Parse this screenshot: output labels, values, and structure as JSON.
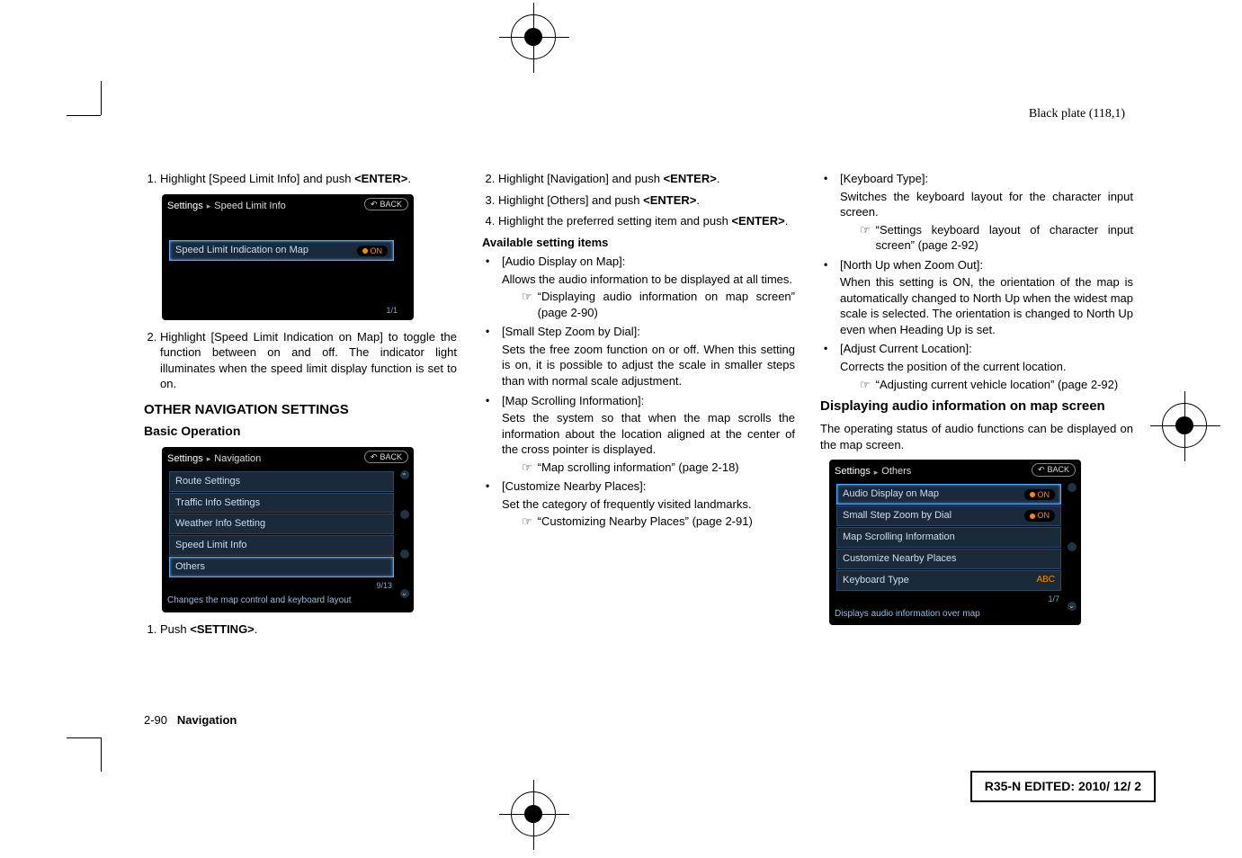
{
  "header": {
    "blackplate": "Black plate (118,1)"
  },
  "col1": {
    "step1": "Highlight [Speed Limit Info] and push ",
    "enter": "<ENTER>",
    "step2": "Highlight [Speed Limit Indication on Map] to toggle the function between on and off. The indicator light illuminates when the speed limit display function is set to on.",
    "sect_other": "OTHER NAVIGATION SETTINGS",
    "sub_basic": "Basic Operation",
    "push_setting_pre": "Push ",
    "setting": "<SETTING>"
  },
  "shot1": {
    "crumb1": "Settings",
    "crumb2": "Speed Limit Info",
    "back": "BACK",
    "row1": "Speed Limit Indication on Map",
    "on": "ON",
    "page": "1/1"
  },
  "shot2": {
    "crumb1": "Settings",
    "crumb2": "Navigation",
    "back": "BACK",
    "r1": "Route Settings",
    "r2": "Traffic Info Settings",
    "r3": "Weather Info Setting",
    "r4": "Speed Limit Info",
    "r5": "Others",
    "page": "9/13",
    "cap": "Changes the map control and keyboard layout"
  },
  "col2": {
    "s2": "Highlight [Navigation] and push ",
    "s3": "Highlight [Others] and push ",
    "s4": "Highlight the preferred setting item and push ",
    "enter": "<ENTER>",
    "avail": "Available setting items",
    "b1t": "[Audio Display on Map]:",
    "b1d": "Allows the audio information to be displayed at all times.",
    "b1r": "“Displaying audio information on map screen” (page 2-90)",
    "b2t": "[Small Step Zoom by Dial]:",
    "b2d": "Sets the free zoom function on or off. When this setting is on, it is possible to adjust the scale in smaller steps than with normal scale adjustment.",
    "b3t": "[Map Scrolling Information]:",
    "b3d": "Sets the system so that when the map scrolls the information about the location aligned at the center of the cross pointer is displayed.",
    "b3r": "“Map scrolling information” (page 2-18)",
    "b4t": "[Customize Nearby Places]:",
    "b4d": "Set the category of frequently visited landmarks.",
    "b4r": "“Customizing Nearby Places” (page 2-91)"
  },
  "col3": {
    "b5t": "[Keyboard Type]:",
    "b5d": "Switches the keyboard layout for the character input screen.",
    "b5r": "“Settings keyboard layout of character input screen” (page 2-92)",
    "b6t": "[North Up when Zoom Out]:",
    "b6d": "When this setting is ON, the orientation of the map is automatically changed to North Up when the widest map scale is selected. The orientation is changed to North Up even when Heading Up is set.",
    "b7t": "[Adjust Current Location]:",
    "b7d": "Corrects the position of the current location.",
    "b7r": "“Adjusting current vehicle location” (page 2-92)",
    "h_disp": "Displaying audio information on map screen",
    "disp_p": "The operating status of audio functions can be displayed on the map screen."
  },
  "shot3": {
    "crumb1": "Settings",
    "crumb2": "Others",
    "back": "BACK",
    "r1": "Audio Display on Map",
    "r2": "Small Step Zoom by Dial",
    "r3": "Map Scrolling Information",
    "r4": "Customize Nearby Places",
    "r5": "Keyboard Type",
    "abc": "ABC",
    "on": "ON",
    "page": "1/7",
    "cap": "Displays audio information over map"
  },
  "footer": {
    "pageno": "2-90",
    "section": "Navigation",
    "editbox": "R35-N EDITED:  2010/ 12/ 2"
  }
}
